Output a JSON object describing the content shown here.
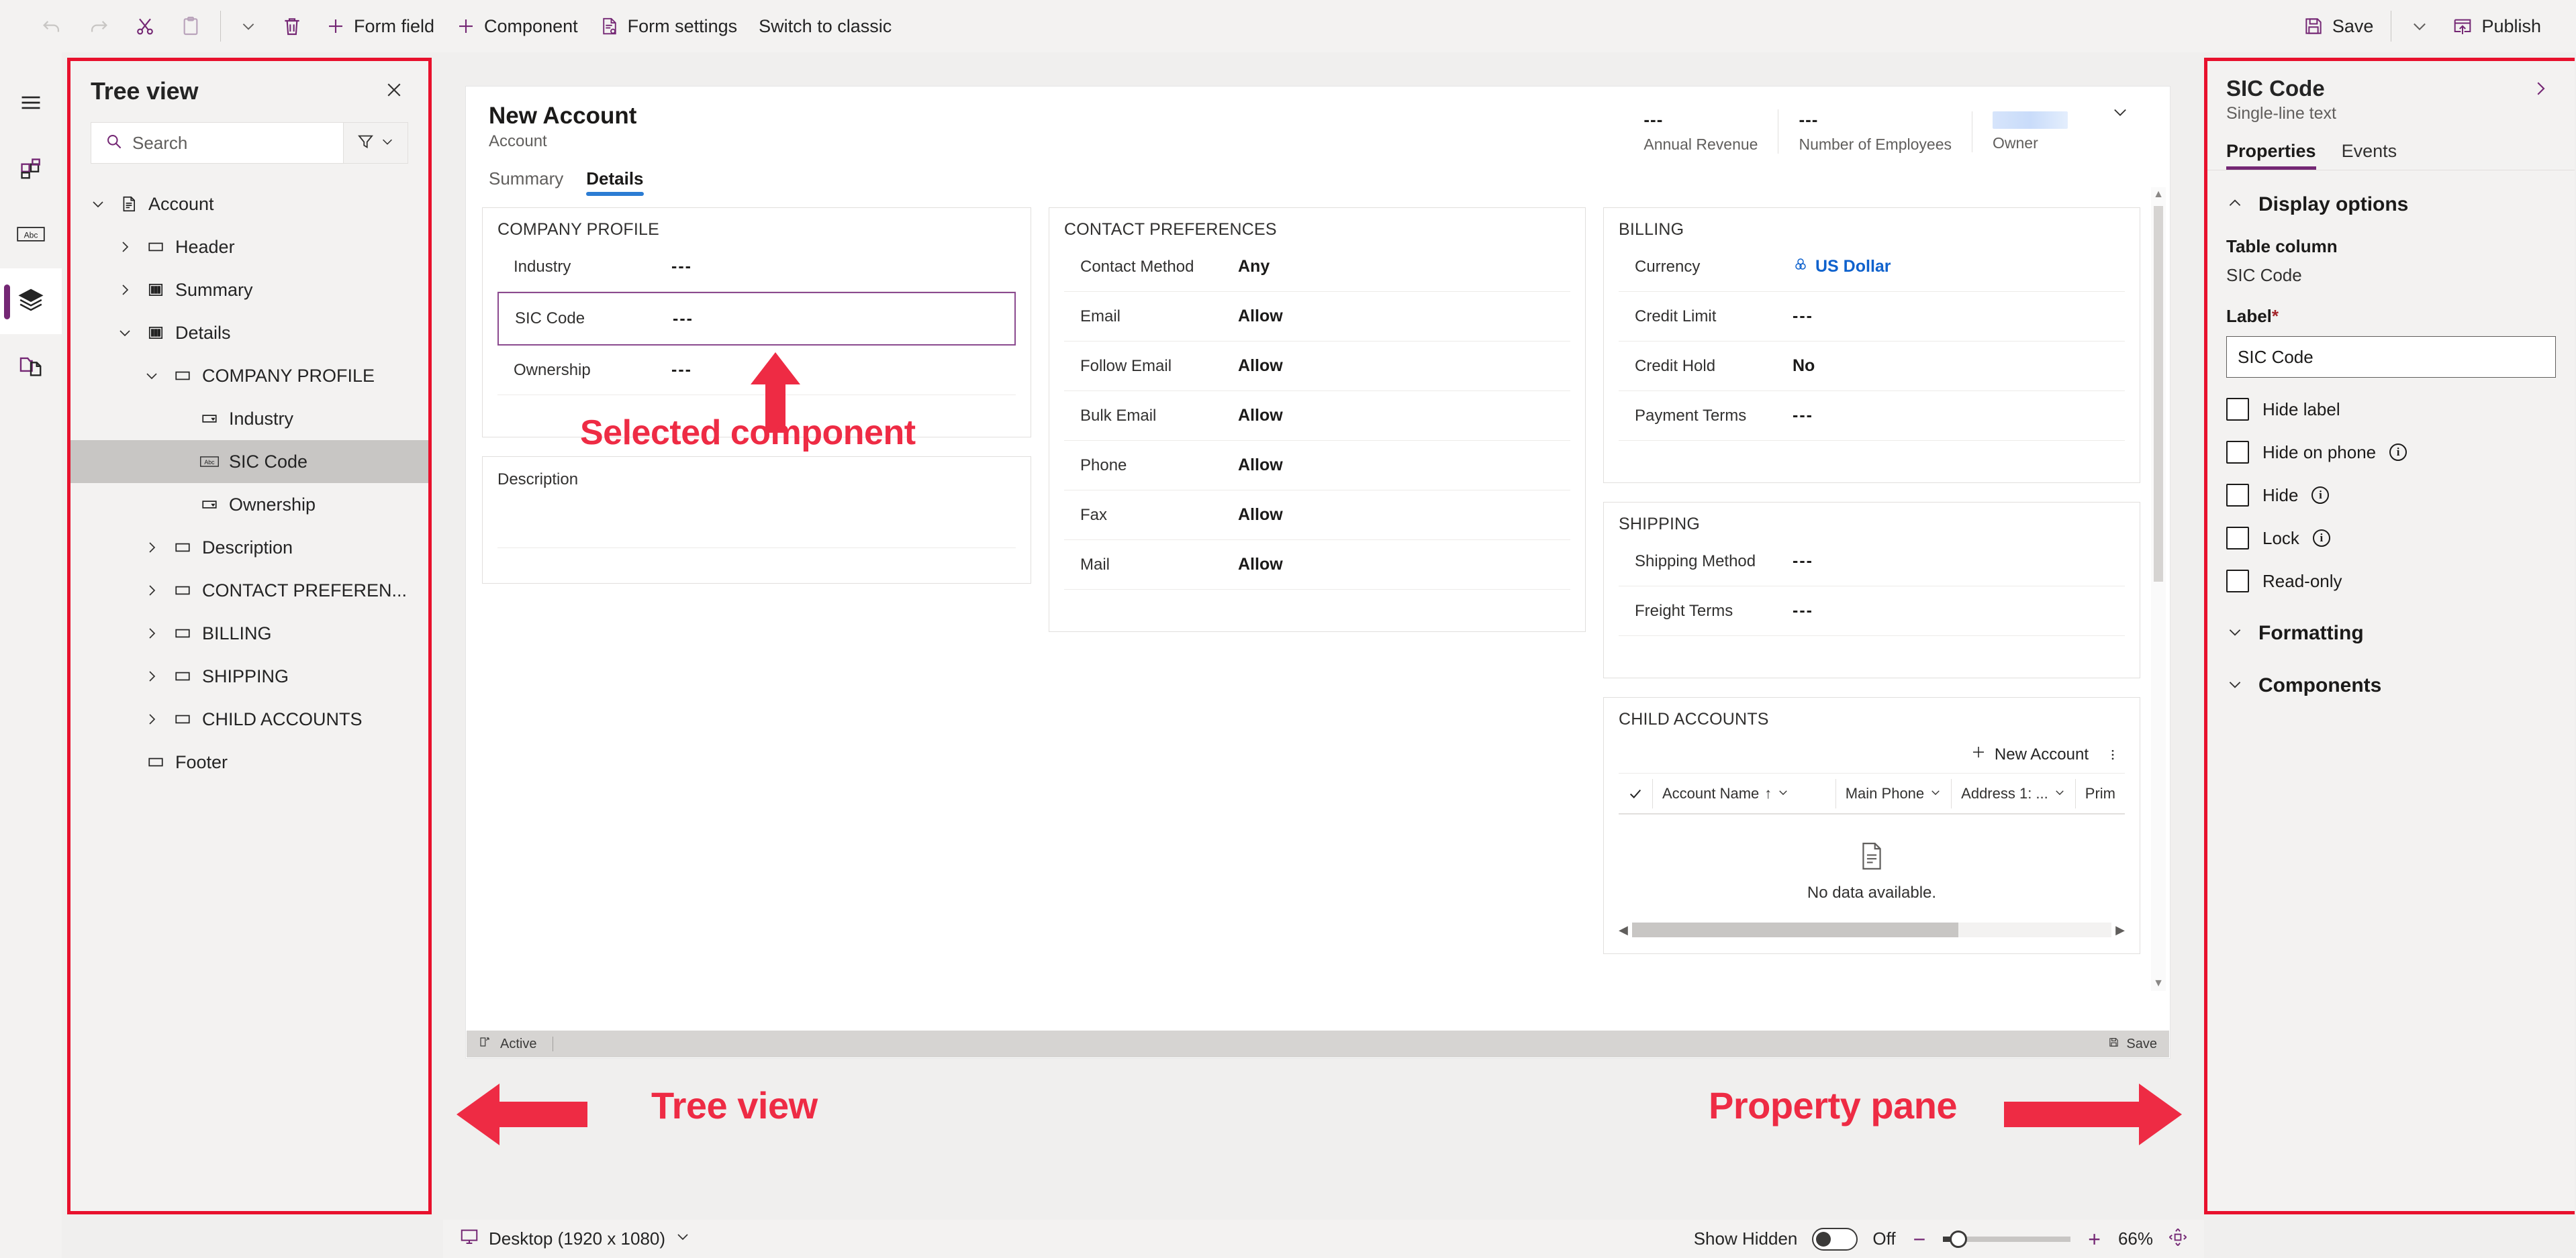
{
  "toolbar": {
    "left_items": [
      {
        "label": "",
        "icon": "undo-icon",
        "disabled": true
      },
      {
        "label": "",
        "icon": "redo-icon",
        "disabled": true
      },
      {
        "label": "",
        "icon": "cut-icon",
        "disabled": false
      },
      {
        "label": "",
        "icon": "paste-icon",
        "disabled": false
      },
      {
        "label": "",
        "icon": "chevron-down-icon",
        "disabled": false
      },
      {
        "label": "",
        "icon": "delete-icon",
        "disabled": false
      },
      {
        "label": "Form field",
        "icon": "plus-icon",
        "disabled": false
      },
      {
        "label": "Component",
        "icon": "plus-icon",
        "disabled": false
      },
      {
        "label": "Form settings",
        "icon": "form-settings-icon",
        "disabled": false
      },
      {
        "label": "Switch to classic",
        "icon": "",
        "disabled": false
      }
    ],
    "save_label": "Save",
    "publish_label": "Publish",
    "save_icon": "save-icon",
    "publish_icon": "publish-icon",
    "save_chevron_icon": "chevron-down-icon"
  },
  "rail": {
    "items": [
      {
        "name": "hamburger-menu-icon",
        "active": false
      },
      {
        "name": "components-icon",
        "active": false
      },
      {
        "name": "table-columns-icon",
        "active": false
      },
      {
        "name": "tree-view-icon",
        "active": true
      },
      {
        "name": "related-icon",
        "active": false
      }
    ]
  },
  "treeview": {
    "title": "Tree view",
    "close_icon": "close-icon",
    "search_placeholder": "Search",
    "search_icon": "search-icon",
    "filter_icon": "filter-icon",
    "filter_chevron_icon": "chevron-down-icon",
    "nodes": [
      {
        "label": "Account",
        "indent": 0,
        "chevron": "down",
        "icon": "form-icon",
        "selected": false
      },
      {
        "label": "Header",
        "indent": 1,
        "chevron": "right",
        "icon": "section-icon",
        "selected": false
      },
      {
        "label": "Summary",
        "indent": 1,
        "chevron": "right",
        "icon": "tab-icon",
        "selected": false
      },
      {
        "label": "Details",
        "indent": 1,
        "chevron": "down",
        "icon": "tab-icon",
        "selected": false
      },
      {
        "label": "COMPANY PROFILE",
        "indent": 2,
        "chevron": "down",
        "icon": "section-icon",
        "selected": false
      },
      {
        "label": "Industry",
        "indent": 3,
        "chevron": "none",
        "icon": "choice-icon",
        "selected": false
      },
      {
        "label": "SIC Code",
        "indent": 3,
        "chevron": "none",
        "icon": "text-icon",
        "selected": true
      },
      {
        "label": "Ownership",
        "indent": 3,
        "chevron": "none",
        "icon": "choice-icon",
        "selected": false
      },
      {
        "label": "Description",
        "indent": 2,
        "chevron": "right",
        "icon": "section-icon",
        "selected": false
      },
      {
        "label": "CONTACT PREFEREN...",
        "indent": 2,
        "chevron": "right",
        "icon": "section-icon",
        "selected": false
      },
      {
        "label": "BILLING",
        "indent": 2,
        "chevron": "right",
        "icon": "section-icon",
        "selected": false
      },
      {
        "label": "SHIPPING",
        "indent": 2,
        "chevron": "right",
        "icon": "section-icon",
        "selected": false
      },
      {
        "label": "CHILD ACCOUNTS",
        "indent": 2,
        "chevron": "right",
        "icon": "section-icon",
        "selected": false
      },
      {
        "label": "Footer",
        "indent": 1,
        "chevron": "none",
        "icon": "section-icon",
        "selected": false
      }
    ]
  },
  "form": {
    "title": "New Account",
    "subtitle": "Account",
    "header_fields": [
      {
        "value": "---",
        "label": "Annual Revenue",
        "redacted": false
      },
      {
        "value": "---",
        "label": "Number of Employees",
        "redacted": false
      },
      {
        "value": "",
        "label": "Owner",
        "redacted": true
      }
    ],
    "header_chevron_icon": "chevron-down-icon",
    "tabs": [
      {
        "label": "Summary",
        "active": false
      },
      {
        "label": "Details",
        "active": true
      }
    ],
    "sections": {
      "company_profile": {
        "title": "COMPANY PROFILE",
        "rows": [
          {
            "label": "Industry",
            "value": "---",
            "selected": false
          },
          {
            "label": "SIC Code",
            "value": "---",
            "selected": true
          },
          {
            "label": "Ownership",
            "value": "---",
            "selected": false
          }
        ]
      },
      "description": {
        "label": "Description"
      },
      "contact_preferences": {
        "title": "CONTACT PREFERENCES",
        "rows": [
          {
            "label": "Contact Method",
            "value": "Any"
          },
          {
            "label": "Email",
            "value": "Allow"
          },
          {
            "label": "Follow Email",
            "value": "Allow"
          },
          {
            "label": "Bulk Email",
            "value": "Allow"
          },
          {
            "label": "Phone",
            "value": "Allow"
          },
          {
            "label": "Fax",
            "value": "Allow"
          },
          {
            "label": "Mail",
            "value": "Allow"
          }
        ]
      },
      "billing": {
        "title": "BILLING",
        "rows": [
          {
            "label": "Currency",
            "value": "US Dollar",
            "link": true,
            "icon": "currency-icon"
          },
          {
            "label": "Credit Limit",
            "value": "---",
            "link": false
          },
          {
            "label": "Credit Hold",
            "value": "No",
            "link": false
          },
          {
            "label": "Payment Terms",
            "value": "---",
            "link": false
          }
        ]
      },
      "shipping": {
        "title": "SHIPPING",
        "rows": [
          {
            "label": "Shipping Method",
            "value": "---"
          },
          {
            "label": "Freight Terms",
            "value": "---"
          }
        ]
      },
      "child_accounts": {
        "title": "CHILD ACCOUNTS",
        "new_button": "New Account",
        "new_icon": "plus-icon",
        "overflow_icon": "more-vertical-icon",
        "columns": [
          {
            "label": "Account Name",
            "sort": "↑"
          },
          {
            "label": "Main Phone",
            "sort": ""
          },
          {
            "label": "Address 1: ...",
            "sort": ""
          },
          {
            "label": "Prim",
            "sort": ""
          }
        ],
        "select_all_icon": "checkmark-icon",
        "empty_icon": "empty-document-icon",
        "empty_text": "No data available."
      }
    },
    "footer": {
      "status_icon": "status-icon",
      "status": "Active",
      "save_icon": "save-icon",
      "save_label": "Save"
    }
  },
  "property_pane": {
    "title": "SIC Code",
    "subtitle": "Single-line text",
    "expand_icon": "chevron-right-icon",
    "tabs": [
      {
        "label": "Properties",
        "active": true
      },
      {
        "label": "Events",
        "active": false
      }
    ],
    "display_options": {
      "header": "Display options",
      "collapse_icon": "chevron-up-icon",
      "table_column_label": "Table column",
      "table_column_value": "SIC Code",
      "label_label": "Label",
      "label_required": "*",
      "label_value": "SIC Code",
      "checkboxes": [
        {
          "label": "Hide label",
          "checked": false,
          "info": false
        },
        {
          "label": "Hide on phone",
          "checked": false,
          "info": true
        },
        {
          "label": "Hide",
          "checked": false,
          "info": true
        },
        {
          "label": "Lock",
          "checked": false,
          "info": true
        },
        {
          "label": "Read-only",
          "checked": false,
          "info": false
        }
      ]
    },
    "collapsed_sections": [
      {
        "label": "Formatting",
        "expand_icon": "chevron-down-icon"
      },
      {
        "label": "Components",
        "expand_icon": "chevron-down-icon"
      }
    ]
  },
  "statusbar": {
    "device_icon": "monitor-icon",
    "device": "Desktop (1920 x 1080)",
    "device_chevron_icon": "chevron-down-icon",
    "show_hidden_label": "Show Hidden",
    "show_hidden_state": "Off",
    "zoom_out_icon": "minus-icon",
    "zoom_in_icon": "plus-icon",
    "zoom_value": "66%",
    "fit_icon": "fit-to-screen-icon"
  },
  "annotations": [
    {
      "text": "Selected component",
      "arrow": "up"
    },
    {
      "text": "Tree view",
      "arrow": "left"
    },
    {
      "text": "Property pane",
      "arrow": "right"
    }
  ],
  "colors": {
    "accent_purple": "#742774",
    "annotation_red": "#ee2b44",
    "tab_blue": "#2b7cd3",
    "link_blue": "#0f62cd"
  }
}
